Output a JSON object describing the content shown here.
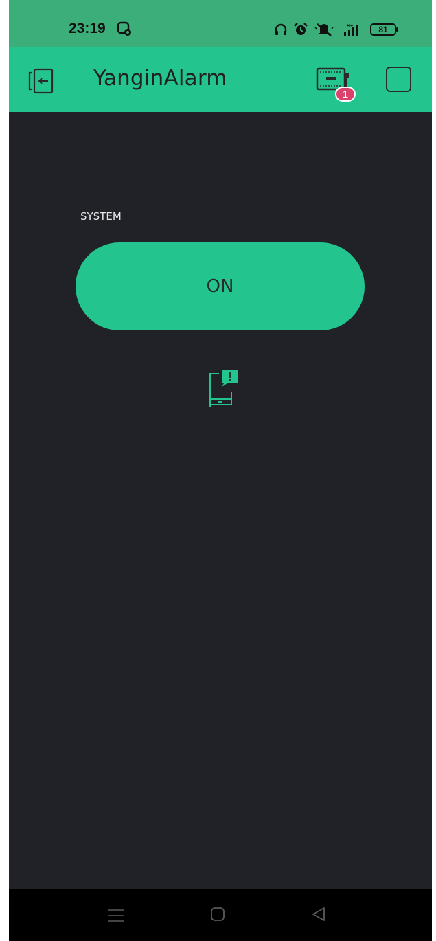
{
  "status_bar": {
    "time": "23:19",
    "battery": "81",
    "icons": [
      "screen-record-icon",
      "headphones-icon",
      "alarm-icon",
      "mute-icon",
      "signal-icon",
      "battery-icon"
    ]
  },
  "header": {
    "title": "YanginAlarm",
    "device_badge_count": "1",
    "icons": [
      "exit-icon",
      "device-icon",
      "square-icon"
    ]
  },
  "widgets": {
    "system_label": "SYSTEM",
    "system_button_label": "ON",
    "notification_icon": "phone-notification-icon"
  },
  "nav_bar": {
    "icons": [
      "menu-icon",
      "home-icon",
      "back-icon"
    ]
  },
  "colors": {
    "status_bar": "#3cae7a",
    "accent": "#23c48e",
    "background": "#212227",
    "badge": "#d9426b"
  }
}
